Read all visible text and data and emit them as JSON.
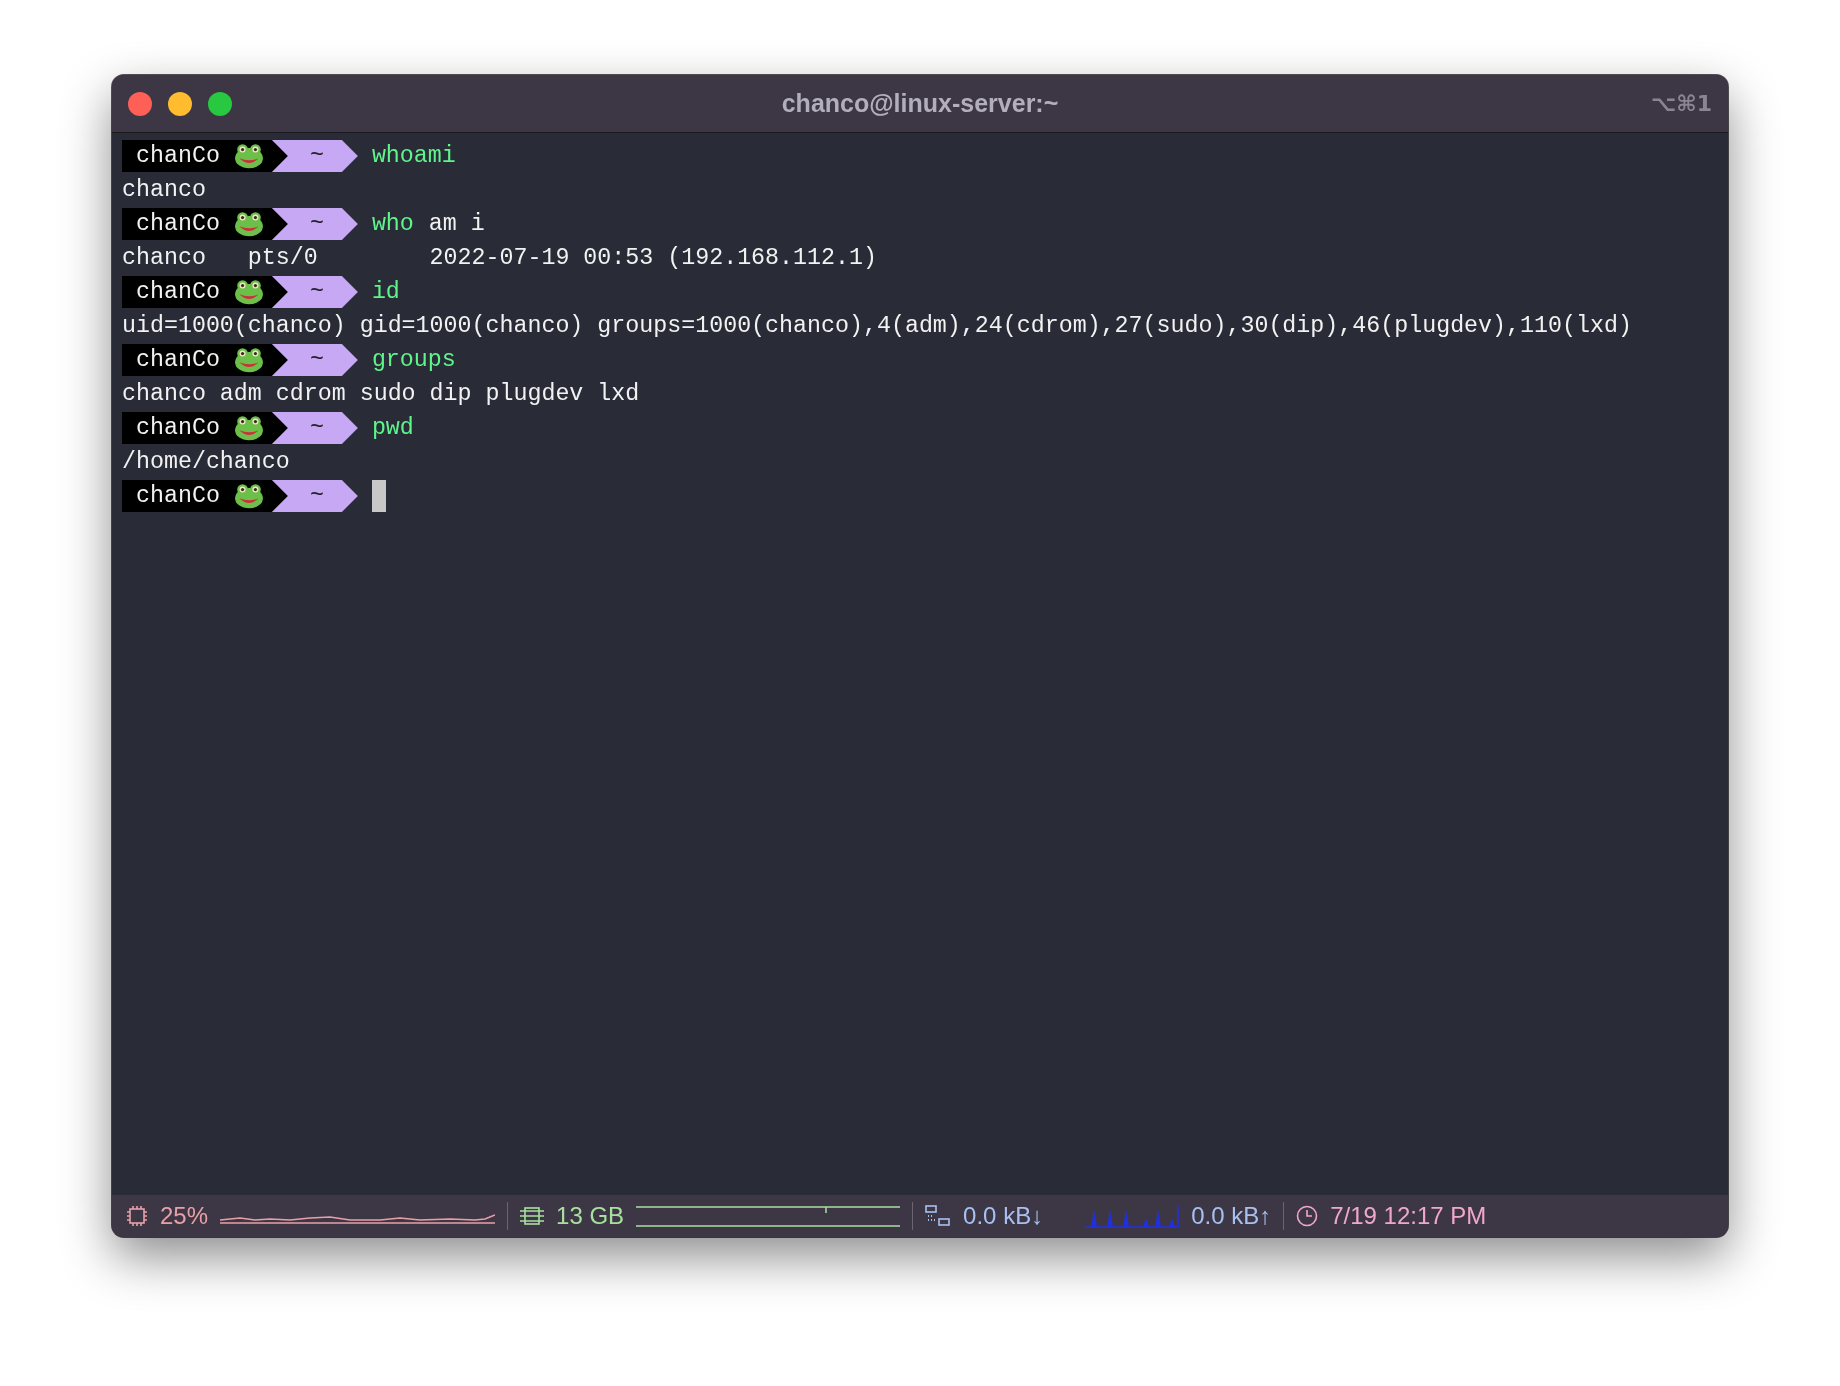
{
  "window": {
    "title": "chanco@linux-server:~",
    "shortcut": "⌥⌘1"
  },
  "lines": [
    {
      "kind": "prompt",
      "user": "chanCo",
      "dir": "~",
      "command": "whoami",
      "cursor": false
    },
    {
      "kind": "output",
      "text": "chanco"
    },
    {
      "kind": "prompt",
      "user": "chanCo",
      "dir": "~",
      "command": "who",
      "args": "am i",
      "cursor": false
    },
    {
      "kind": "output",
      "text": "chanco   pts/0        2022-07-19 00:53 (192.168.112.1)"
    },
    {
      "kind": "prompt",
      "user": "chanCo",
      "dir": "~",
      "command": "id",
      "cursor": false
    },
    {
      "kind": "output",
      "text": "uid=1000(chanco) gid=1000(chanco) groups=1000(chanco),4(adm),24(cdrom),27(sudo),30(dip),46(plugdev),110(lxd)"
    },
    {
      "kind": "prompt",
      "user": "chanCo",
      "dir": "~",
      "command": "groups",
      "cursor": false
    },
    {
      "kind": "output",
      "text": "chanco adm cdrom sudo dip plugdev lxd"
    },
    {
      "kind": "prompt",
      "user": "chanCo",
      "dir": "~",
      "command": "pwd",
      "cursor": false
    },
    {
      "kind": "output",
      "text": "/home/chanco"
    },
    {
      "kind": "prompt",
      "user": "chanCo",
      "dir": "~",
      "cursor": true
    }
  ],
  "status_bar": {
    "cpu": "25%",
    "memory": "13 GB",
    "download": "0.0 kB↓",
    "upload": "0.0 kB↑",
    "clock": "7/19 12:17 PM"
  }
}
